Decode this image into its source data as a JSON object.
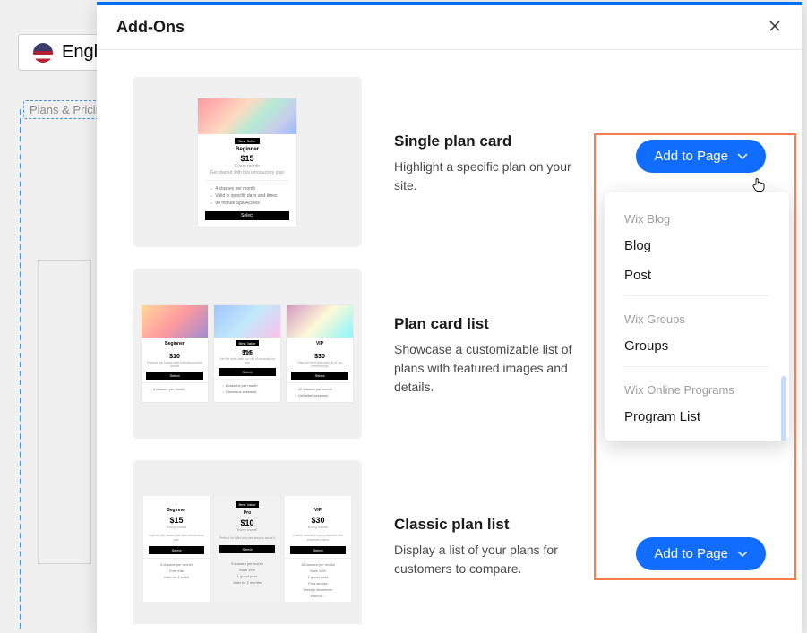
{
  "background": {
    "language": "Engl",
    "label": "Plans & Pricing"
  },
  "modal": {
    "title": "Add-Ons",
    "close_aria": "Close"
  },
  "addons": [
    {
      "title": "Single plan card",
      "description": "Highlight a specific plan on your site."
    },
    {
      "title": "Plan card list",
      "description": "Showcase a customizable list of plans with featured images and details."
    },
    {
      "title": "Classic plan list",
      "description": "Display a list of your plans for customers to compare."
    }
  ],
  "cta": {
    "label": "Add to Page"
  },
  "dropdown": {
    "sections": [
      {
        "label": "Wix Blog",
        "items": [
          "Blog",
          "Post"
        ]
      },
      {
        "label": "Wix Groups",
        "items": [
          "Groups"
        ]
      },
      {
        "label": "Wix Online Programs",
        "items": [
          "Program List"
        ]
      }
    ]
  },
  "preview": {
    "single": {
      "badge": "Best Seller",
      "tier": "Beginner",
      "price": "$15",
      "sub": "Every month",
      "desc": "Get started with this introductory plan",
      "feats": [
        "4 classes per month",
        "Valid in specific days and times",
        "90 minute Spa Access"
      ],
      "button": "Select"
    },
    "list": {
      "cards": [
        {
          "tier": "Beginner",
          "badge": "",
          "price": "$10",
          "desc": "Explore the basics with this introductory course",
          "button": "Select",
          "feats": [
            "4 classes per month"
          ]
        },
        {
          "tier": "Pro",
          "badge": "Best Value",
          "price": "$15",
          "desc": "Get the skills with our set of products for you",
          "button": "Select",
          "feats": [
            "8 classes per month",
            "Checkbox sessions"
          ]
        },
        {
          "tier": "VIP",
          "badge": "",
          "price": "$30",
          "desc": "Take the next step with all of our membership",
          "button": "Select",
          "feats": [
            "12 classes per month",
            "Unlimited sessions"
          ]
        }
      ]
    },
    "classic": {
      "cards": [
        {
          "tier": "Beginner",
          "price": "$15",
          "sub": "Every month",
          "desc": "Explore the basics with this introductory plan",
          "button": "Select",
          "lines": [
            "4 classes per month",
            "Free trial",
            "Valid for 1 week"
          ]
        },
        {
          "tier": "Pro",
          "badge": "Best Value",
          "price": "$10",
          "sub": "Every month",
          "desc": "Perfect for folks who are serious about it",
          "button": "Select",
          "lines": [
            "9 classes per month",
            "Save 15%",
            "1 guest pass",
            "Valid for 2 months"
          ]
        },
        {
          "tier": "VIP",
          "price": "$30",
          "sub": "Every month",
          "desc": "Unlock access to your potential with exclusive perks",
          "button": "Select",
          "lines": [
            "18 classes per month",
            "Save 28%",
            "1 guest pass",
            "Pool access",
            "Weekly newsletter",
            "Valid for..."
          ]
        }
      ]
    }
  }
}
